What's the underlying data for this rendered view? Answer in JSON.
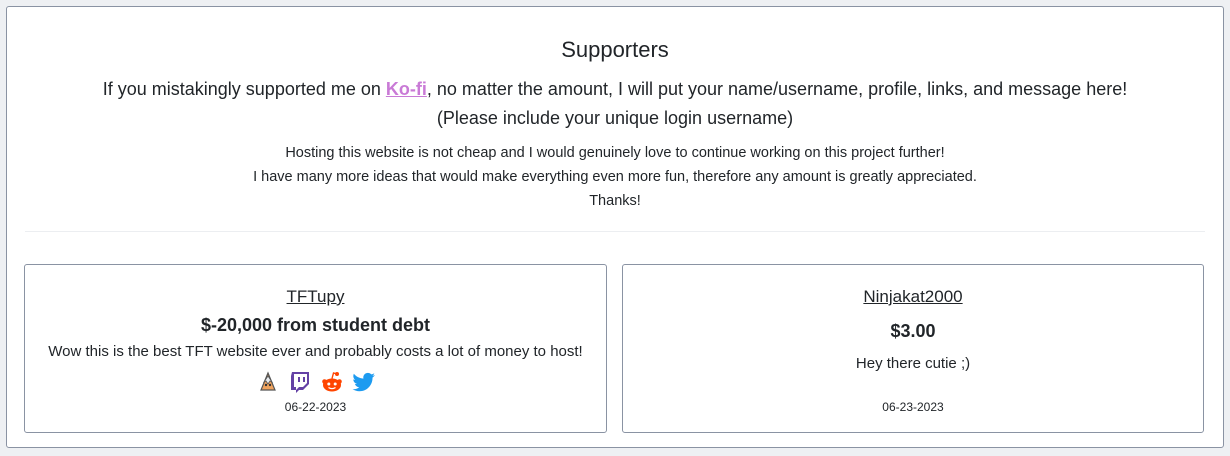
{
  "page": {
    "title": "Supporters",
    "intro_before": "If you mistakingly supported me on ",
    "kofi_link": "Ko-fi",
    "intro_after": ", no matter the amount, I will put your name/username, profile, links, and message here!",
    "intro_line2": "(Please include your unique login username)",
    "note_lines": [
      "Hosting this website is not cheap and I would genuinely love to continue working on this project further!",
      "I have many more ideas that would make everything even more fun, therefore any amount is greatly appreciated.",
      "Thanks!"
    ]
  },
  "supporters": [
    {
      "name": "TFTupy",
      "amount": "$-20,000 from student debt",
      "message": "Wow this is the best TFT website ever and probably costs a lot of money to host!",
      "date": "06-22-2023",
      "icons": [
        "profile-icon",
        "twitch-icon",
        "reddit-icon",
        "twitter-icon"
      ]
    },
    {
      "name": "Ninjakat2000",
      "amount": "$3.00",
      "message": "Hey there cutie ;)",
      "date": "06-23-2023",
      "icons": []
    }
  ],
  "colors": {
    "kofi_link": "#c97ad6",
    "twitch": "#6441a5",
    "reddit": "#ff4500",
    "twitter": "#1d9bf0",
    "card_border": "#8a93a3"
  }
}
